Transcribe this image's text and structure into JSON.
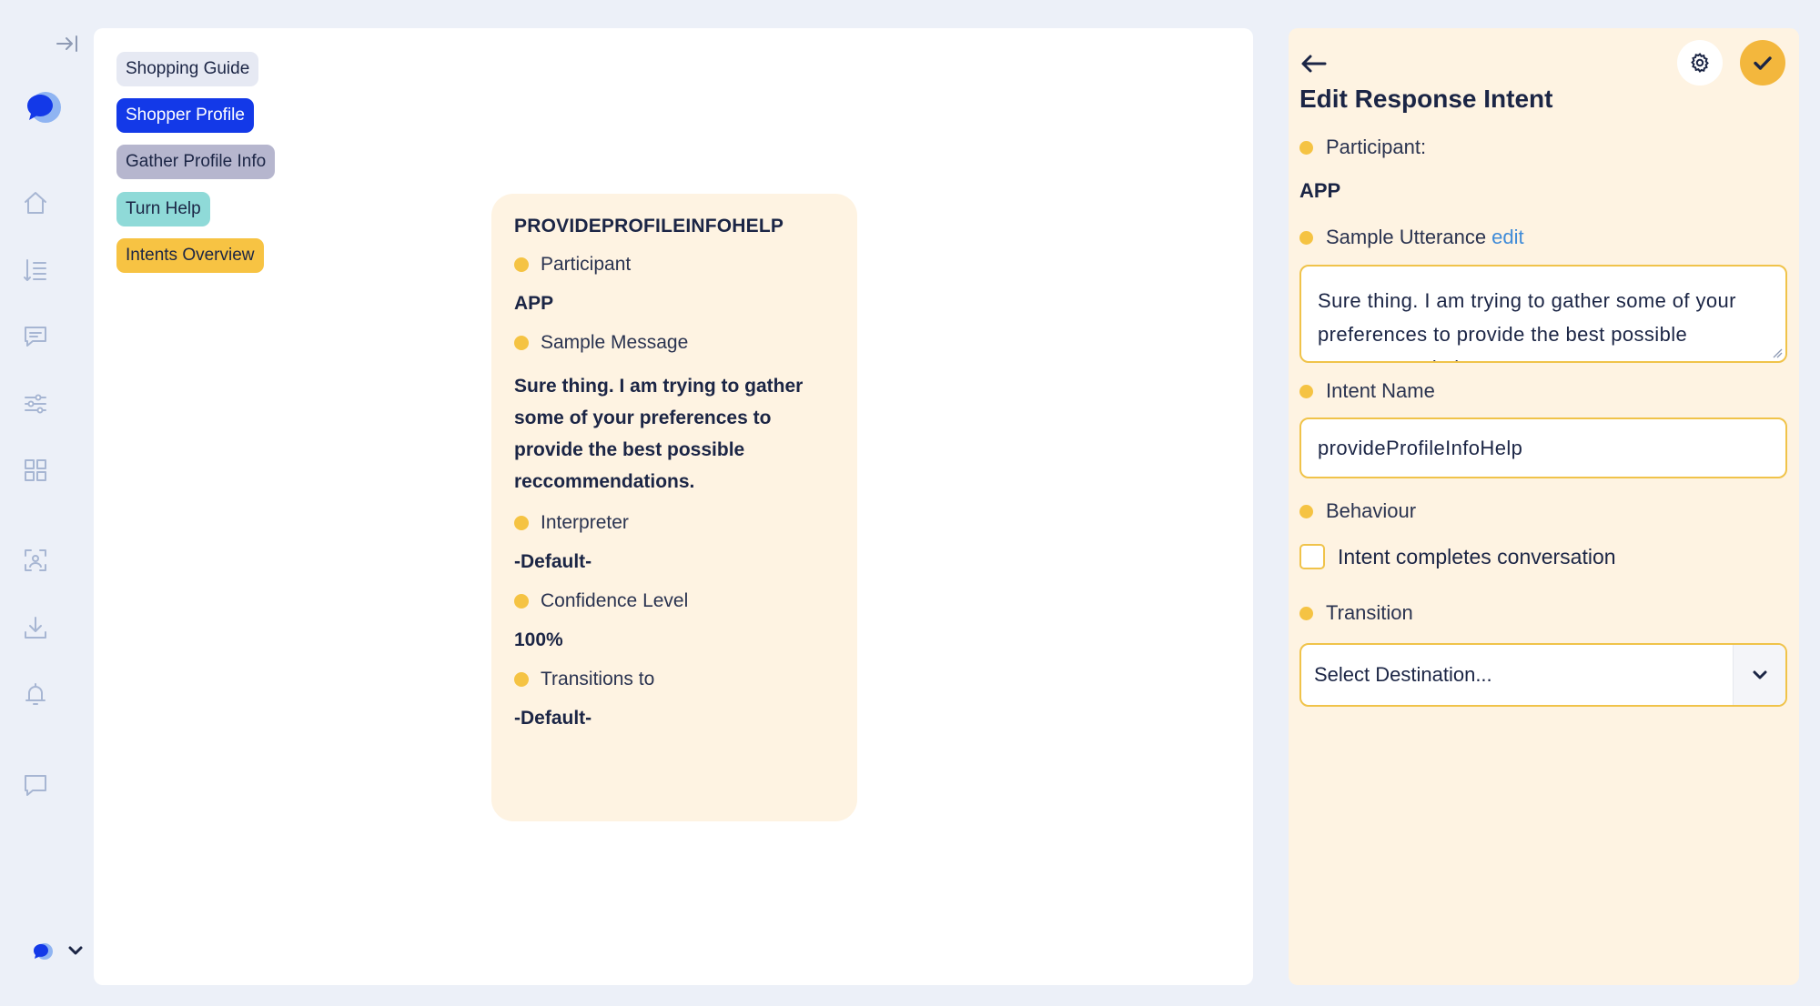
{
  "sidebar": {
    "icons": [
      "collapse-sidebar-icon",
      "app-logo",
      "home-icon",
      "list-icon",
      "chat-icon",
      "sliders-icon",
      "grid-icon",
      "scan-icon",
      "download-icon",
      "bell-icon",
      "message-icon",
      "workspace-logo",
      "chevron-down-icon"
    ]
  },
  "canvas": {
    "tags": [
      {
        "label": "Shopping Guide",
        "color": "#e6e9f3"
      },
      {
        "label": "Shopper Profile",
        "color": "#1339e8"
      },
      {
        "label": "Gather Profile Info",
        "color": "#b6b6ce"
      },
      {
        "label": "Turn Help",
        "color": "#8fdad8"
      },
      {
        "label": "Intents Overview",
        "color": "#f7c343"
      }
    ],
    "node": {
      "title": "PROVIDEPROFILEINFOHELP",
      "participant_label": "Participant",
      "participant_value": "APP",
      "sample_message_label": "Sample Message",
      "sample_message_value": "Sure thing. I am trying to gather some of your preferences to provide the best possible reccommendations.",
      "interpreter_label": "Interpreter",
      "interpreter_value": "-Default-",
      "confidence_label": "Confidence Level",
      "confidence_value": "100%",
      "transitions_label": "Transitions to",
      "transitions_value": "-Default-"
    }
  },
  "panel": {
    "title": "Edit Response Intent",
    "participant_label": "Participant:",
    "participant_value": "APP",
    "sample_utterance_label": "Sample Utterance",
    "edit_link": "edit",
    "sample_utterance_value": "Sure thing. I am trying to gather some of your preferences to provide the best possible reccommendations.",
    "intent_name_label": "Intent Name",
    "intent_name_value": "provideProfileInfoHelp",
    "behaviour_label": "Behaviour",
    "checkbox_label": "Intent completes conversation",
    "checkbox_checked": false,
    "transition_label": "Transition",
    "transition_select_value": "Select Destination..."
  },
  "colors": {
    "accent_yellow": "#f5c343",
    "brand_blue": "#1339e8",
    "node_bg": "#fef3e2",
    "page_bg": "#ecf0f8"
  }
}
